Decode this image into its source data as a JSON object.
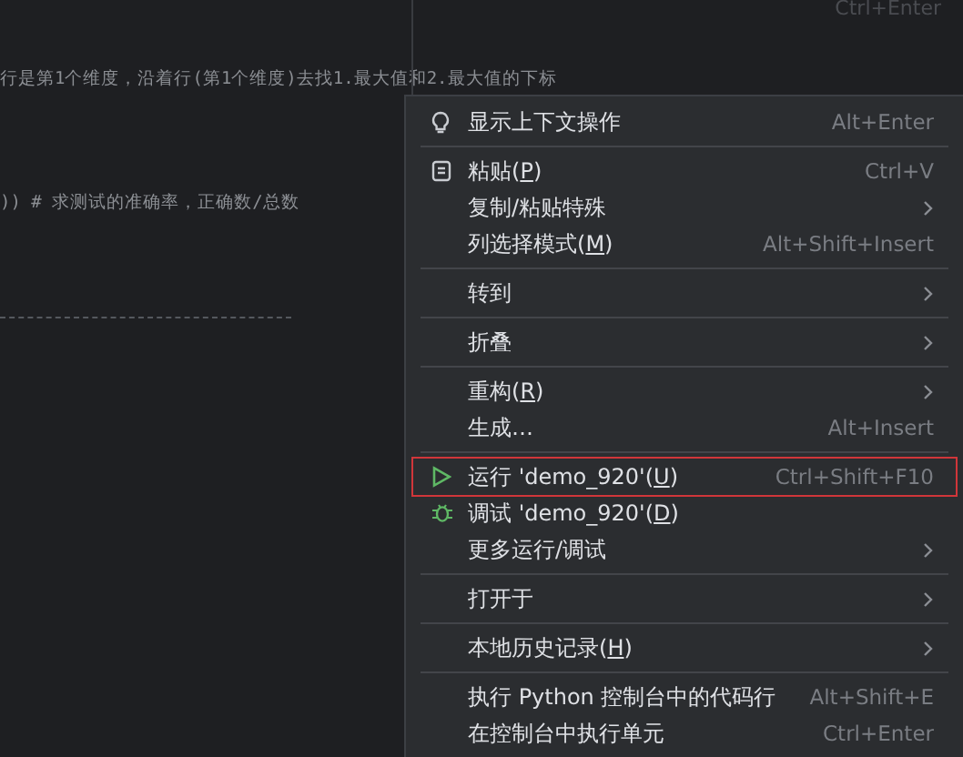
{
  "background_shortcut": "Ctrl+Enter",
  "code_lines": [
    {
      "text": "行是第1个维度，沿着行(第1个维度)去找1.最大值和2.最大值的下标"
    },
    {
      "text": "))  # 求测试的准确率，正确数/总数"
    }
  ],
  "menu": {
    "groups": [
      {
        "items": [
          {
            "kind": "bulb",
            "label": "显示上下文操作",
            "shortcut": "Alt+Enter",
            "has_submenu": false,
            "outlined": false
          }
        ]
      },
      {
        "items": [
          {
            "kind": "paste",
            "label": "粘贴(",
            "mnemonic": "P",
            "label_end": ")",
            "shortcut": "Ctrl+V",
            "has_submenu": false,
            "outlined": false
          },
          {
            "kind": "plain",
            "label": "复制/粘贴特殊",
            "has_submenu": true,
            "outlined": false
          },
          {
            "kind": "plain",
            "label": "列选择模式(",
            "mnemonic": "M",
            "label_end": ")",
            "shortcut": "Alt+Shift+Insert",
            "has_submenu": false,
            "outlined": false
          }
        ]
      },
      {
        "items": [
          {
            "kind": "plain",
            "label": "转到",
            "has_submenu": true,
            "outlined": false
          }
        ]
      },
      {
        "items": [
          {
            "kind": "plain",
            "label": "折叠",
            "has_submenu": true,
            "outlined": false
          }
        ]
      },
      {
        "items": [
          {
            "kind": "plain",
            "label": "重构(",
            "mnemonic": "R",
            "label_end": ")",
            "has_submenu": true,
            "outlined": false
          },
          {
            "kind": "plain",
            "label": "生成…",
            "shortcut": "Alt+Insert",
            "has_submenu": false,
            "outlined": false
          }
        ]
      },
      {
        "items": [
          {
            "kind": "run",
            "label": "运行 'demo_920'(",
            "mnemonic": "U",
            "label_end": ")",
            "shortcut": "Ctrl+Shift+F10",
            "has_submenu": false,
            "outlined": true
          },
          {
            "kind": "debug",
            "label": "调试 'demo_920'(",
            "mnemonic": "D",
            "label_end": ")",
            "has_submenu": false,
            "outlined": false
          },
          {
            "kind": "plain",
            "label": "更多运行/调试",
            "has_submenu": true,
            "outlined": false
          }
        ]
      },
      {
        "items": [
          {
            "kind": "plain",
            "label": "打开于",
            "has_submenu": true,
            "outlined": false
          }
        ]
      },
      {
        "items": [
          {
            "kind": "plain",
            "label": "本地历史记录(",
            "mnemonic": "H",
            "label_end": ")",
            "has_submenu": true,
            "outlined": false
          }
        ]
      },
      {
        "items": [
          {
            "kind": "plain",
            "label": "执行 Python 控制台中的代码行",
            "shortcut": "Alt+Shift+E",
            "has_submenu": false,
            "outlined": false
          },
          {
            "kind": "plain",
            "label": "在控制台中执行单元",
            "shortcut": "Ctrl+Enter",
            "has_submenu": false,
            "outlined": false
          }
        ]
      }
    ]
  }
}
